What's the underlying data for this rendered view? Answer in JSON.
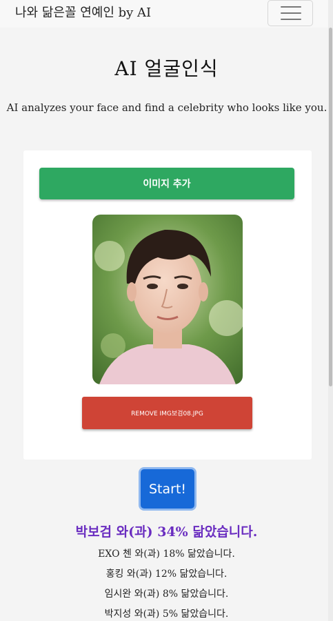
{
  "navbar": {
    "brand": "나와 닮은꼴 연예인 by AI",
    "menu_icon": "hamburger-icon"
  },
  "header": {
    "title": "AI 얼굴인식",
    "subtitle": "AI analyzes your face and find a celebrity who looks like you."
  },
  "upload": {
    "add_label": "이미지 추가",
    "remove_label": "REMOVE IMG보검08.JPG"
  },
  "start_label": "Start!",
  "results": {
    "top": "박보검 와(과) 34% 닮았습니다.",
    "others": [
      "EXO 첸 와(과) 18% 닮았습니다.",
      "홍킹 와(과) 12% 닮았습니다.",
      "임시완 와(과) 8% 닮았습니다.",
      "박지성 와(과) 5% 닮았습니다."
    ]
  },
  "colors": {
    "add_button": "#2ea861",
    "remove_button": "#cf4436",
    "start_button": "#1769d8",
    "result_highlight": "#6a2dc0"
  }
}
